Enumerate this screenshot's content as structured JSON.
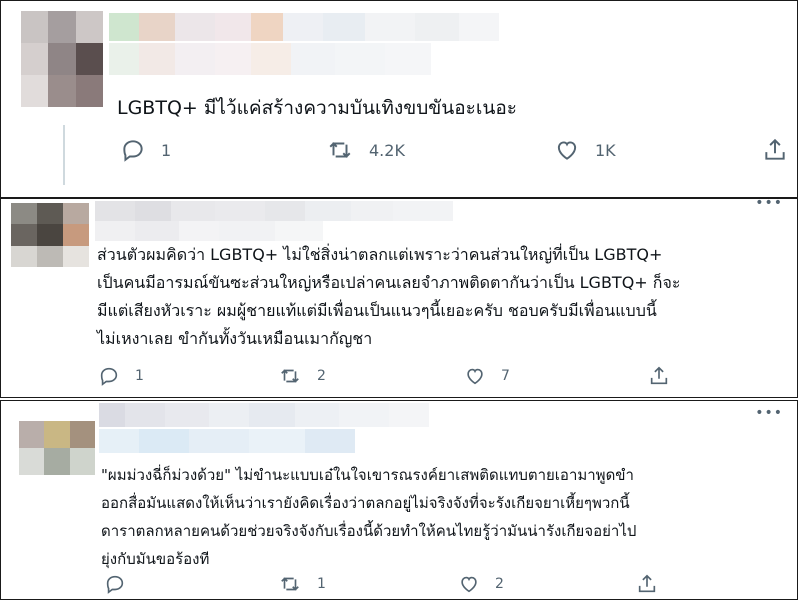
{
  "tweets": [
    {
      "text": "LGBTQ+ มีไว้แค่สร้างความบันเทิงขบขันอะเนอะ",
      "reply_count": "1",
      "retweet_count": "4.2K",
      "like_count": "1K"
    },
    {
      "lines": [
        "ส่วนตัวผมคิดว่า LGBTQ+ ไม่ใช่สิ่งน่าตลกแต่เพราะว่าคนส่วนใหญ่ที่เป็น LGBTQ+",
        "เป็นคนมีอารมณ์ขันซะส่วนใหญ่หรือเปล่าคนเลยจำภาพติดตากันว่าเป็น LGBTQ+ ก็จะ",
        "มีแต่เสียงหัวเราะ ผมผู้ชายแท้แต่มีเพื่อนเป็นแนวๆนี้เยอะครับ ชอบครับมีเพื่อนแบบนี้",
        "ไม่เหงาเลย ขำกันทั้งวันเหมือนเมากัญชา"
      ],
      "reply_count": "1",
      "retweet_count": "2",
      "like_count": "7",
      "more": "•••"
    },
    {
      "lines": [
        "\"ผมม่วงฉี่ก็ม่วงด้วย\" ไม่ขำนะแบบเอ๋ในใจเขารณรงค์ยาเสพติดแทบตายเอามาพูดขำ",
        "ออกสื่อมันแสดงให้เห็นว่าเรายังคิดเรื่องว่าตลกอยู่ไม่จริงจังที่จะรังเกียจยาเหี้ยๆพวกนี้",
        "ดาราตลกหลายคนด้วยช่วยจริงจังกับเรื่องนี้ด้วยทำให้คนไทยรู้ว่ามันน่ารังเกียจอย่าไป",
        "ยุ่งกับมันขอร้องที"
      ],
      "reply_count": "",
      "retweet_count": "1",
      "like_count": "2",
      "more": "•••"
    }
  ],
  "icons": [
    "reply-icon",
    "retweet-icon",
    "like-icon",
    "share-icon"
  ],
  "colors": {
    "text": "#0f1419",
    "secondary": "#536471",
    "border": "#1a1a1a"
  }
}
